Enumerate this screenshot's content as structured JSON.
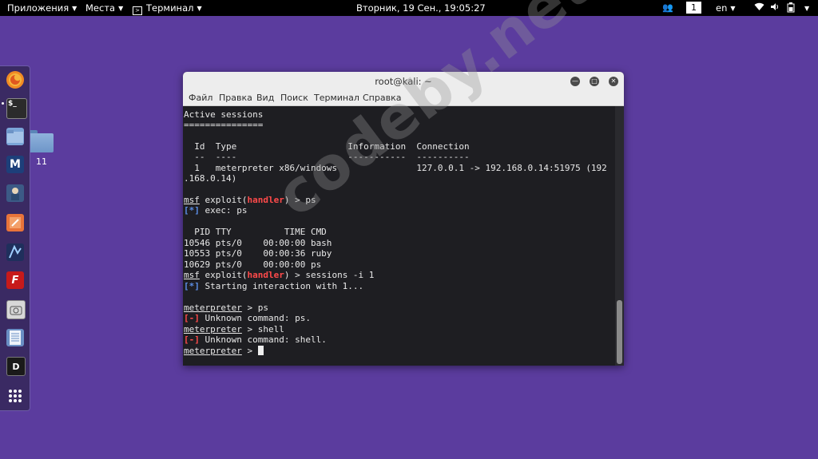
{
  "topbar": {
    "apps": "Приложения",
    "places": "Места",
    "terminal": "Терминал",
    "clock": "Вторник, 19 Сен., 19:05:27",
    "workspace": "1",
    "lang": "en"
  },
  "desktop": {
    "folder_label": "11"
  },
  "dock": {
    "items": [
      "firefox-icon",
      "terminal-icon",
      "files-icon",
      "metasploit-icon",
      "armitage-icon",
      "burpsuite-icon",
      "maltego-icon",
      "faraday-icon",
      "cutycapt-icon",
      "leafpad-icon",
      "dradis-icon",
      "show-apps-icon"
    ]
  },
  "window": {
    "title": "root@kali: ~",
    "menu": [
      "Файл",
      "Правка",
      "Вид",
      "Поиск",
      "Терминал",
      "Справка"
    ]
  },
  "terminal": {
    "l1": "Active sessions",
    "l2": "===============",
    "l3": "  Id  Type                     Information  Connection",
    "l4": "  --  ----                     -----------  ----------",
    "l5": "  1   meterpreter x86/windows               127.0.0.1 -> 192.168.0.14:51975 (192",
    "l6": ".168.0.14)",
    "msf": "msf",
    "exploit": " exploit(",
    "handler": "handler",
    "ps_cmd": ") > ps",
    "star": "[*]",
    "exec": " exec: ps",
    "p_hdr": "  PID TTY          TIME CMD",
    "p1": "10546 pts/0    00:00:00 bash",
    "p2": "10553 pts/0    00:00:36 ruby",
    "p3": "10629 pts/0    00:00:00 ps",
    "sess_cmd": ") > sessions -i 1",
    "starting": " Starting interaction with 1...",
    "meterpreter": "meterpreter",
    "m_ps": " > ps",
    "minus": "[-]",
    "unk_ps": " Unknown command: ps.",
    "m_shell": " > shell",
    "unk_shell": " Unknown command: shell.",
    "m_prompt": " > "
  },
  "watermark": "codeby.net"
}
